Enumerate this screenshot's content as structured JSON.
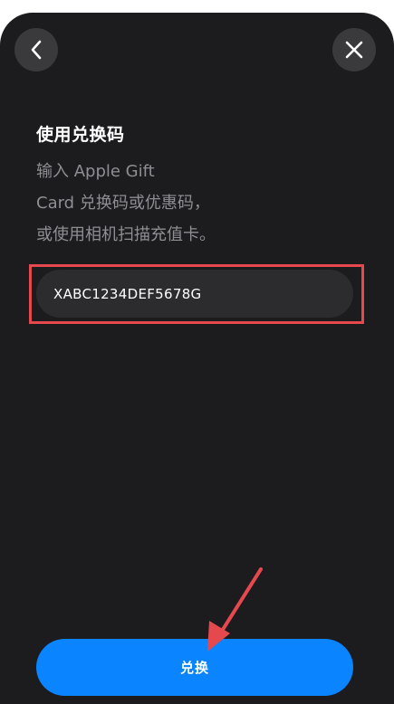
{
  "header": {
    "back_icon": "chevron-left-icon",
    "close_icon": "close-icon"
  },
  "content": {
    "title": "使用兑换码",
    "description_lines": [
      "输入 Apple Gift",
      "Card 兑换码或优惠码，",
      "或使用相机扫描充值卡。"
    ]
  },
  "code_input": {
    "value": "XABC1234DEF5678G"
  },
  "redeem_button": {
    "label": "兑换"
  },
  "colors": {
    "background": "#1c1c1e",
    "button_blue": "#0a84ff",
    "annotation_red": "#e5484d"
  }
}
